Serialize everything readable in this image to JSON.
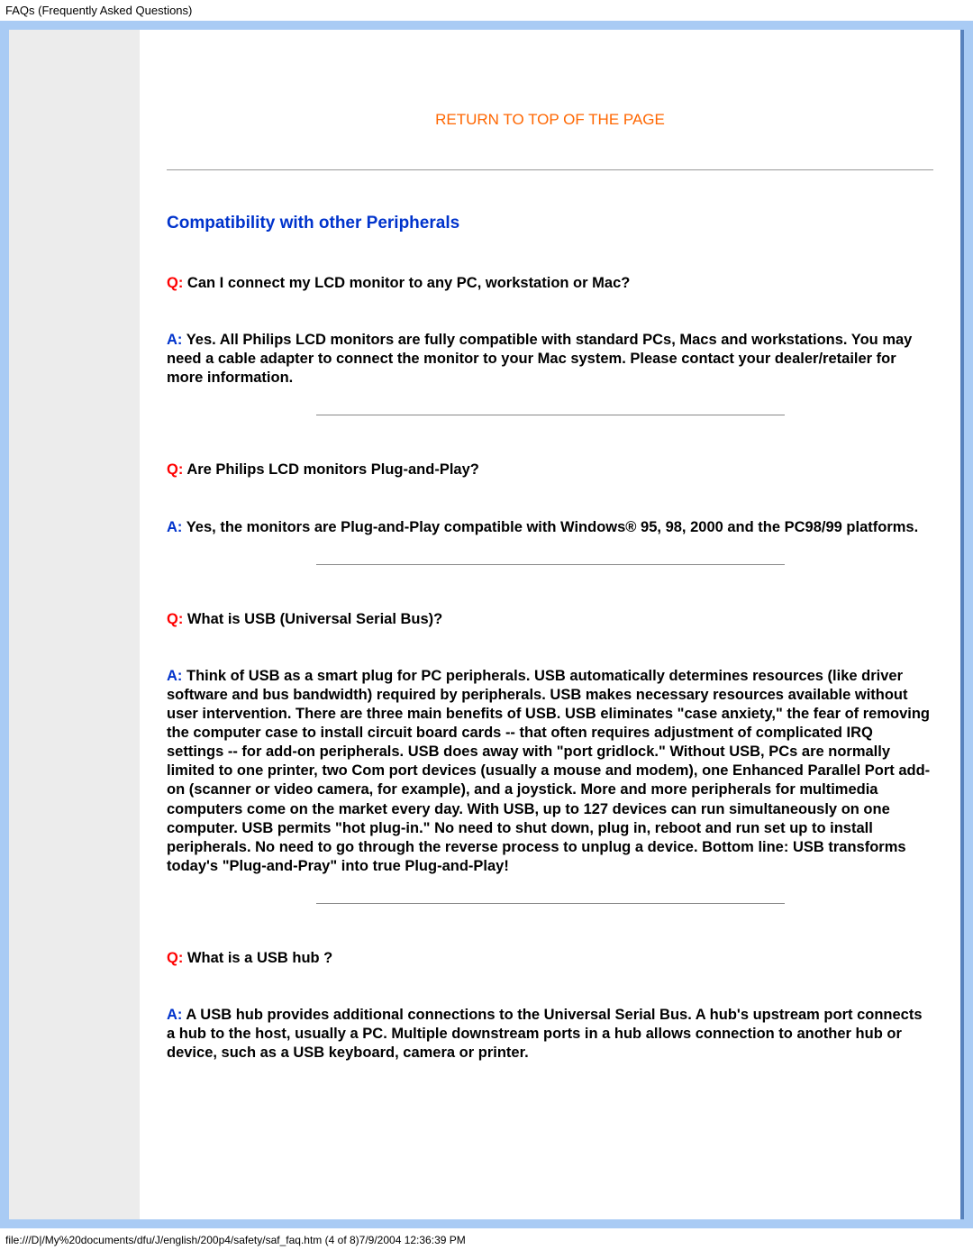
{
  "header": {
    "title": "FAQs (Frequently Asked Questions)"
  },
  "content": {
    "return_link": "RETURN TO TOP OF THE PAGE",
    "section_title": "Compatibility with other Peripherals",
    "q_prefix": "Q:",
    "a_prefix": "A:",
    "faqs": [
      {
        "q": " Can I connect my LCD monitor to any PC, workstation or Mac?",
        "a": " Yes. All Philips LCD monitors are fully compatible with standard PCs, Macs and workstations. You may need a cable adapter to connect the monitor to your Mac system. Please contact your dealer/retailer for more information."
      },
      {
        "q": " Are Philips LCD monitors Plug-and-Play?",
        "a": " Yes, the monitors are Plug-and-Play compatible with Windows® 95, 98, 2000 and the PC98/99 platforms."
      },
      {
        "q": " What is USB (Universal Serial Bus)?",
        "a": " Think of USB as a smart plug for PC peripherals. USB automatically determines resources (like driver software and bus bandwidth) required by peripherals. USB makes necessary resources available without user intervention. There are three main benefits of USB. USB eliminates \"case anxiety,\" the fear of removing the computer case to install circuit board cards -- that often requires adjustment of complicated IRQ settings -- for add-on peripherals. USB does away with \"port gridlock.\" Without USB, PCs are normally limited to one printer, two Com port devices (usually a mouse and modem), one Enhanced Parallel Port add-on (scanner or video camera, for example), and a joystick. More and more peripherals for multimedia computers come on the market every day. With USB, up to 127 devices can run simultaneously on one computer. USB permits \"hot plug-in.\" No need to shut down, plug in, reboot and run set up to install peripherals. No need to go through the reverse process to unplug a device. Bottom line: USB transforms today's \"Plug-and-Pray\" into true Plug-and-Play!"
      },
      {
        "q": " What is a USB hub ?",
        "a": " A USB hub provides additional connections to the Universal Serial Bus. A hub's upstream port connects a hub to the host, usually a PC. Multiple downstream ports in a hub allows connection to another hub or device, such as a USB keyboard, camera or printer."
      }
    ]
  },
  "footer": {
    "path": "file:///D|/My%20documents/dfu/J/english/200p4/safety/saf_faq.htm (4 of 8)7/9/2004 12:36:39 PM"
  }
}
